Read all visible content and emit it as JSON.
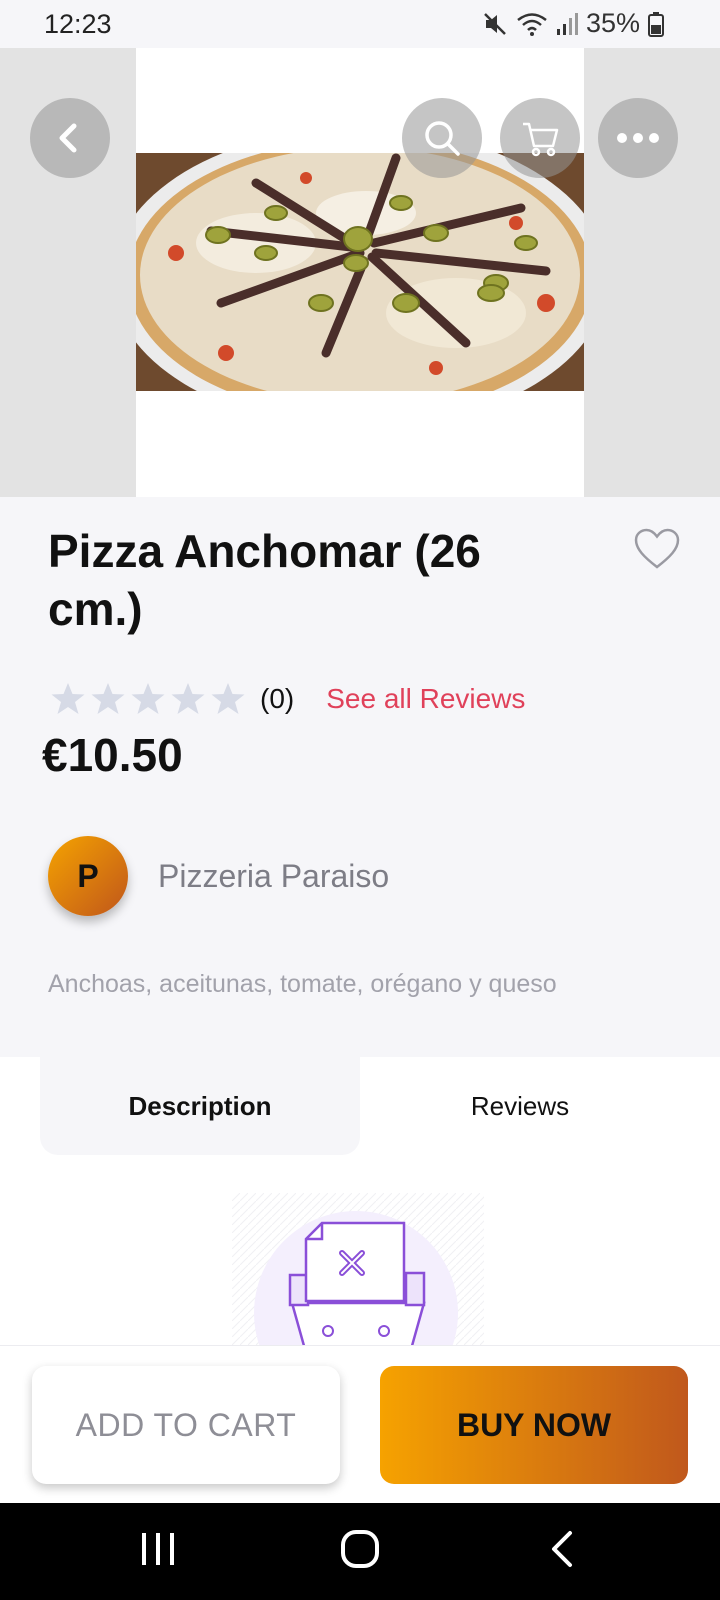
{
  "status_bar": {
    "time": "12:23",
    "battery": "35%"
  },
  "hero": {
    "back_icon": "chevron-left-icon",
    "search_icon": "search-icon",
    "cart_icon": "cart-icon",
    "more_icon": "more-horizontal-icon"
  },
  "product": {
    "title": "Pizza Anchomar (26 cm.)",
    "rating": 0,
    "rating_count": "(0)",
    "see_reviews": "See all Reviews",
    "price": "€10.50",
    "short_description": "Anchoas, aceitunas, tomate, orégano y queso"
  },
  "store": {
    "initial": "P",
    "name": "Pizzeria Paraiso"
  },
  "tabs": [
    {
      "label": "Description",
      "active": true
    },
    {
      "label": "Reviews",
      "active": false
    }
  ],
  "actions": {
    "add_to_cart": "ADD TO CART",
    "buy_now": "BUY NOW"
  },
  "colors": {
    "accent": "#e0415a",
    "brand_gradient_start": "#f6a200",
    "brand_gradient_end": "#c0581c",
    "background": "#f6f6f9",
    "illustration": "#8a4fd8"
  }
}
